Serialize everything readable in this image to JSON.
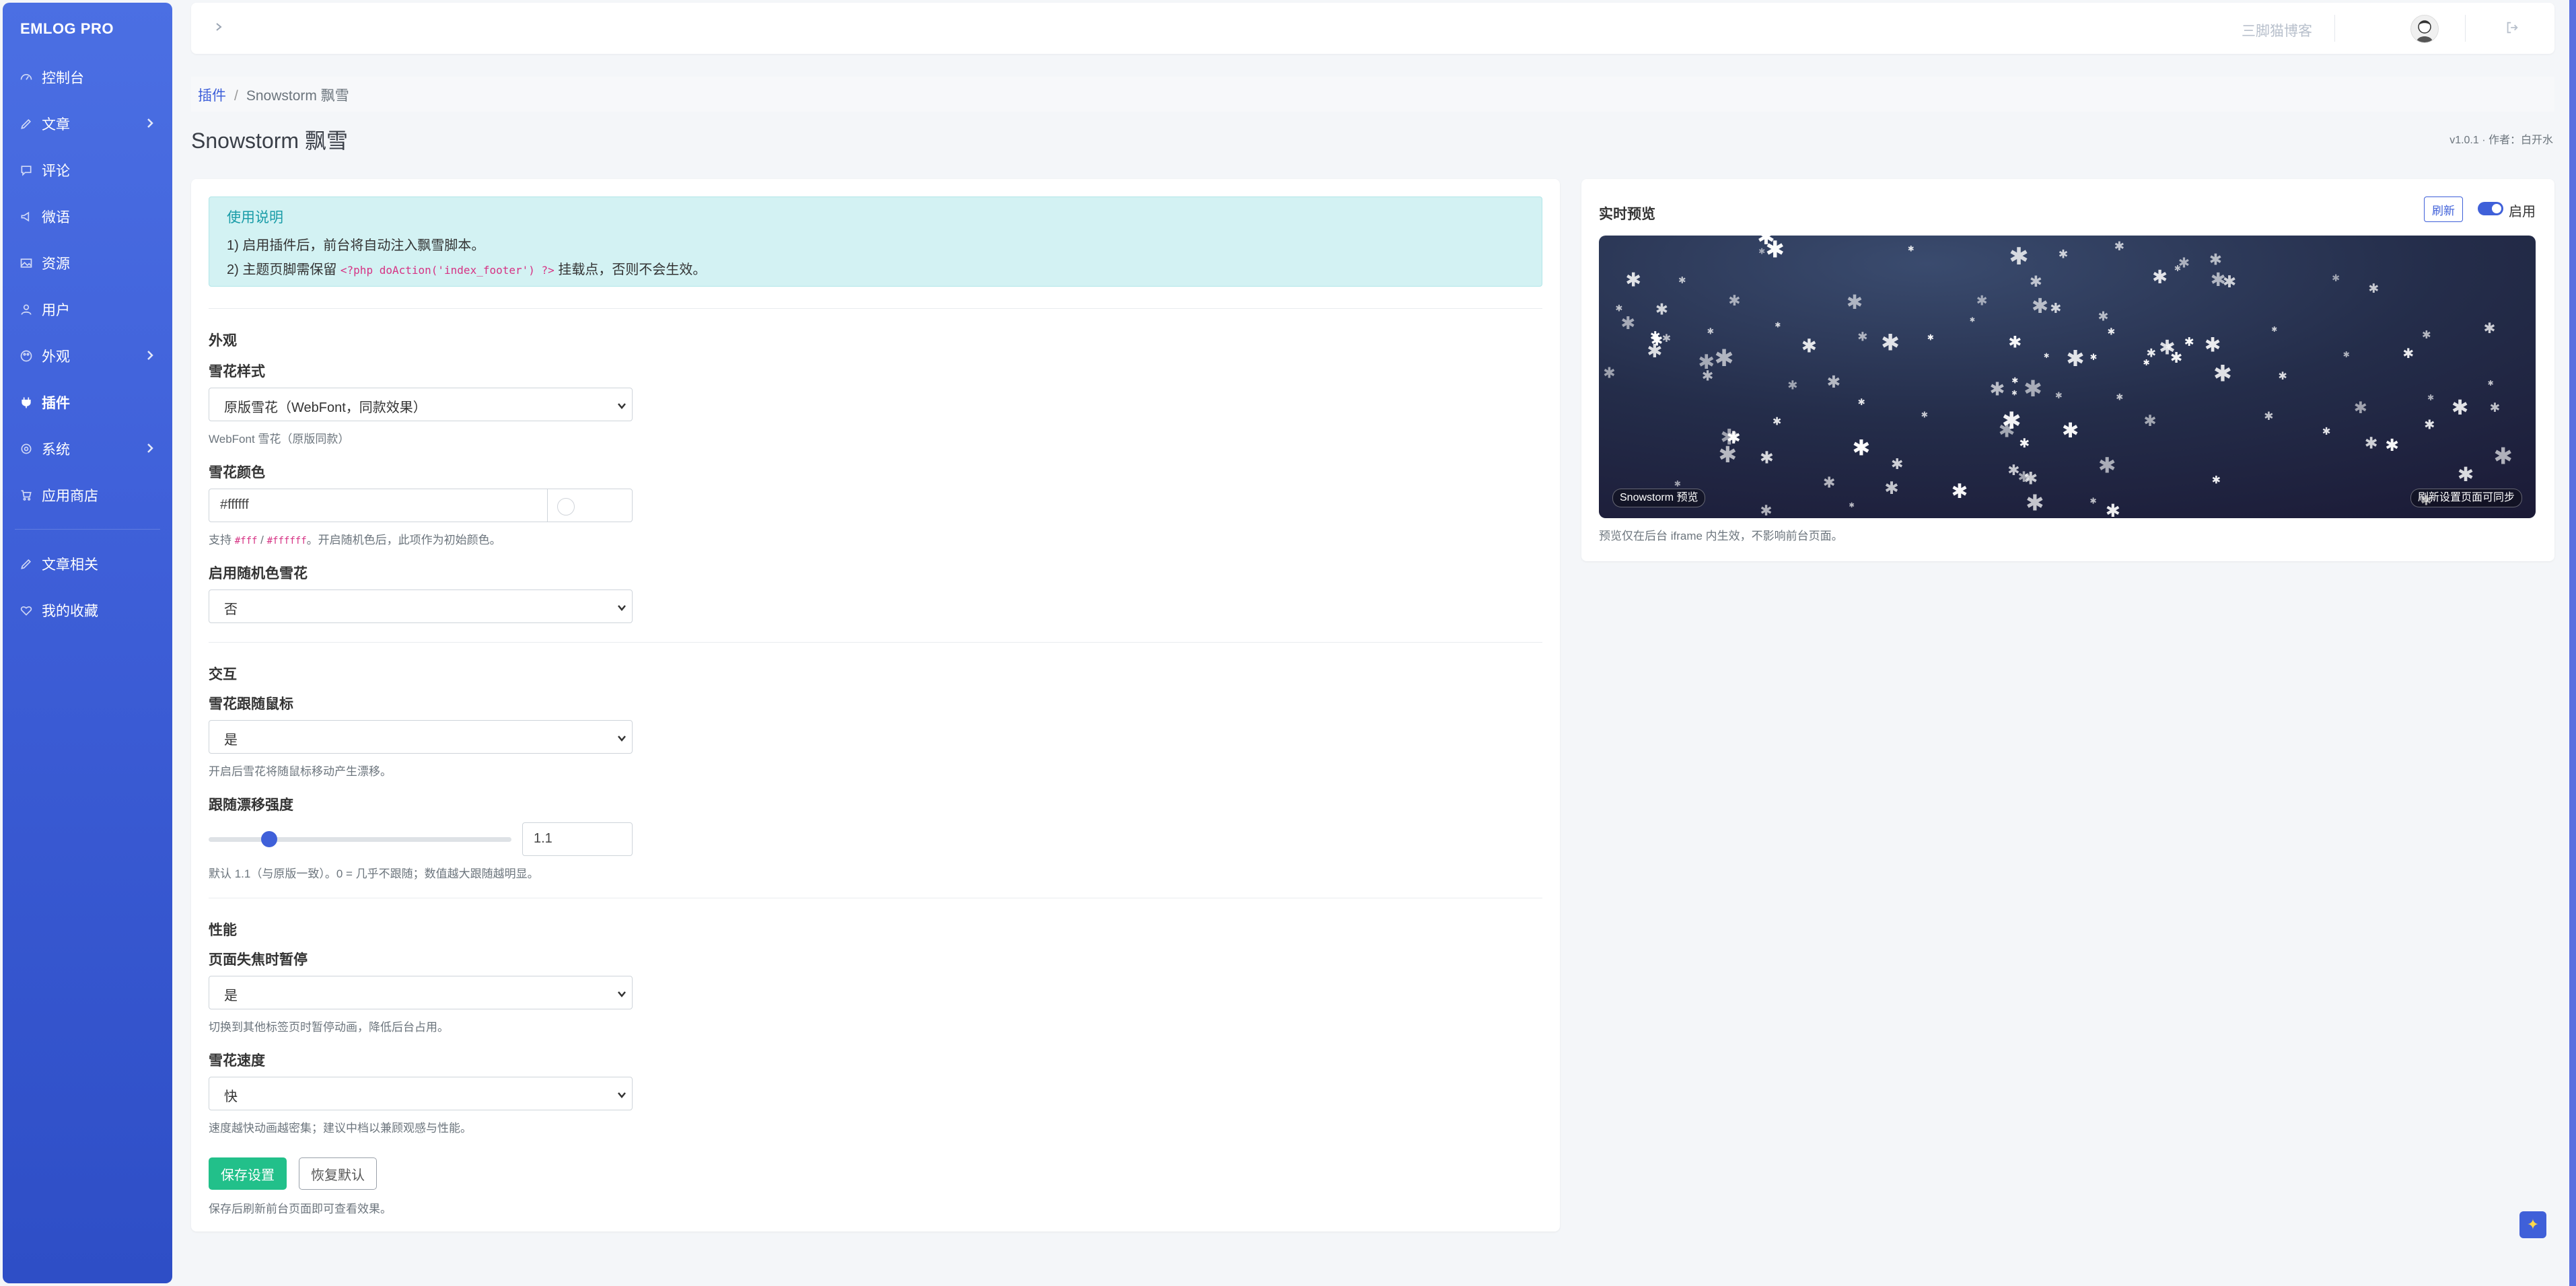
{
  "sidebar": {
    "brand": "EMLOG PRO",
    "items": [
      {
        "label": "控制台",
        "icon": "dashboard-icon"
      },
      {
        "label": "文章",
        "icon": "pencil-icon",
        "has_submenu": true
      },
      {
        "label": "评论",
        "icon": "comment-icon"
      },
      {
        "label": "微语",
        "icon": "megaphone-icon"
      },
      {
        "label": "资源",
        "icon": "image-icon"
      },
      {
        "label": "用户",
        "icon": "user-icon"
      },
      {
        "label": "外观",
        "icon": "palette-icon",
        "has_submenu": true
      },
      {
        "label": "插件",
        "icon": "plug-icon",
        "active": true
      },
      {
        "label": "系统",
        "icon": "gear-icon",
        "has_submenu": true
      },
      {
        "label": "应用商店",
        "icon": "cart-icon"
      }
    ],
    "extra_items": [
      {
        "label": "文章相关",
        "icon": "pencil-icon"
      },
      {
        "label": "我的收藏",
        "icon": "heart-icon"
      }
    ]
  },
  "topbar": {
    "site_name": "三脚猫博客"
  },
  "breadcrumb": {
    "parent": "插件",
    "separator": "/",
    "current": "Snowstorm 飘雪"
  },
  "page": {
    "title": "Snowstorm 飘雪",
    "version": "v1.0.1 · 作者：白开水"
  },
  "usage": {
    "title": "使用说明",
    "line1": "1) 启用插件后，前台将自动注入飘雪脚本。",
    "line2_pre": "2) 主题页脚需保留 ",
    "line2_code": "<?php doAction('index_footer') ?>",
    "line2_post": " 挂载点，否则不会生效。"
  },
  "appearance": {
    "section": "外观",
    "style_label": "雪花样式",
    "style_value": "原版雪花（WebFont，同款效果）",
    "style_help": "WebFont 雪花（原版同款）",
    "color_label": "雪花颜色",
    "color_value": "#ffffff",
    "color_swatch": "#ffffff",
    "color_help_pre": "支持 ",
    "color_help_code1": "#fff",
    "color_help_mid": " / ",
    "color_help_code2": "#ffffff",
    "color_help_post": "。开启随机色后，此项作为初始颜色。",
    "random_label": "启用随机色雪花",
    "random_value": "否"
  },
  "interaction": {
    "section": "交互",
    "follow_label": "雪花跟随鼠标",
    "follow_value": "是",
    "follow_help": "开启后雪花将随鼠标移动产生漂移。",
    "drift_label": "跟随漂移强度",
    "drift_value": "1.1",
    "drift_fraction": 0.2,
    "drift_help": "默认 1.1（与原版一致）。0 = 几乎不跟随；数值越大跟随越明显。"
  },
  "performance": {
    "section": "性能",
    "pause_label": "页面失焦时暂停",
    "pause_value": "是",
    "pause_help": "切换到其他标签页时暂停动画，降低后台占用。",
    "speed_label": "雪花速度",
    "speed_value": "快",
    "speed_help": "速度越快动画越密集；建议中档以兼顾观感与性能。"
  },
  "actions": {
    "save": "保存设置",
    "reset": "恢复默认",
    "note": "保存后刷新前台页面即可查看效果。"
  },
  "preview": {
    "title": "实时预览",
    "refresh": "刷新",
    "enable_label": "启用",
    "badge_left": "Snowstorm 预览",
    "badge_right": "刷新设置页面可同步",
    "note": "预览仅在后台 iframe 内生效，不影响前台页面。"
  },
  "colors": {
    "sidebar": "#3f60d9",
    "primary": "#3f60d9",
    "success": "#22c08a",
    "alert_bg": "#d3f2f3"
  }
}
